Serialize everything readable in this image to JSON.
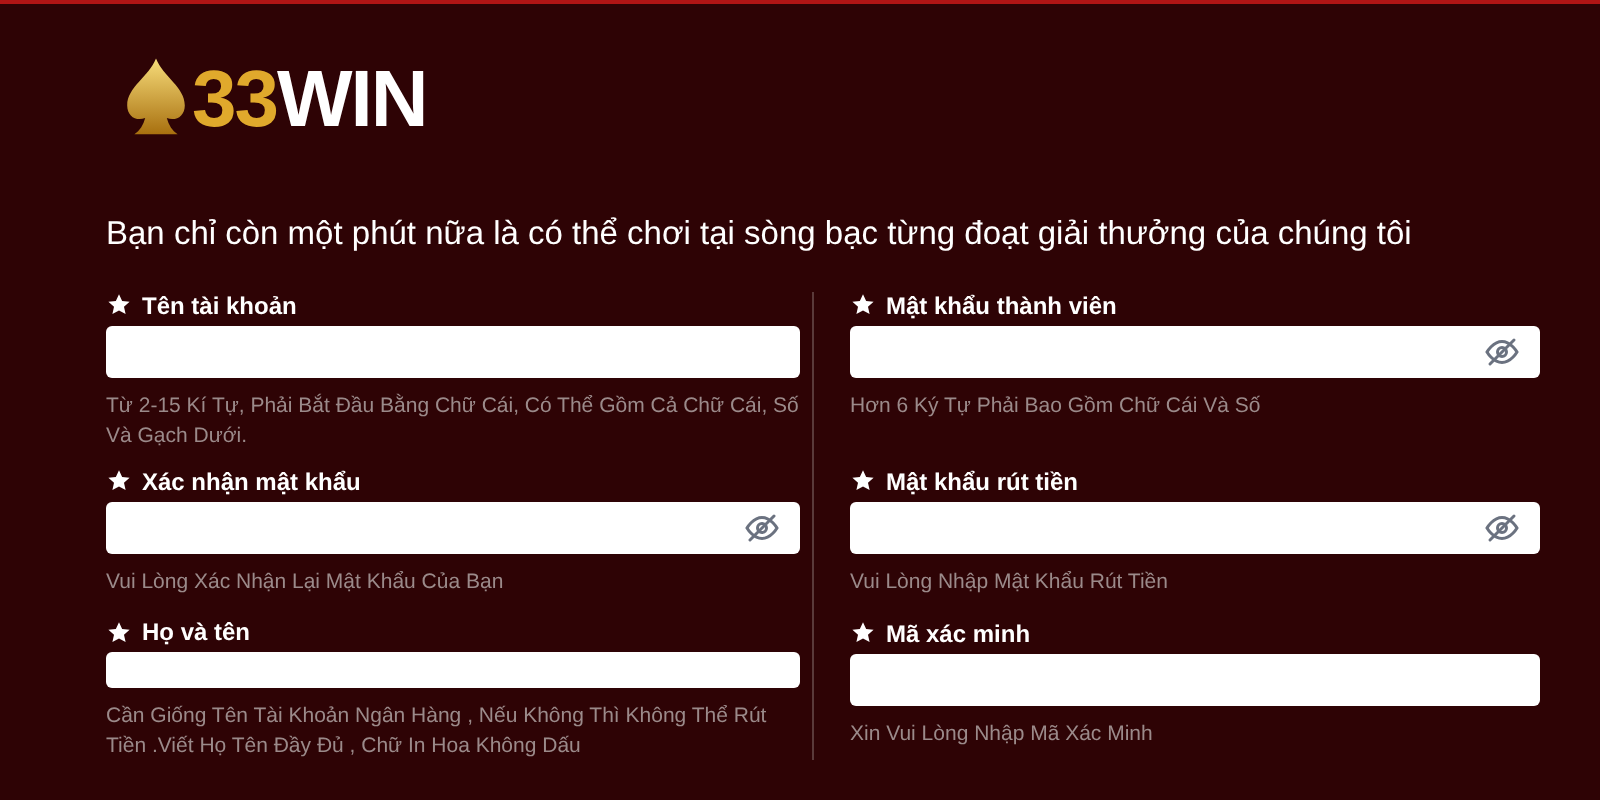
{
  "logo": {
    "digits": "33",
    "word": "WIN"
  },
  "heading": "Bạn chỉ còn một phút nữa là có thể chơi tại sòng bạc từng đoạt giải thưởng của chúng tôi",
  "columns": [
    {
      "fields": [
        {
          "kind": "text",
          "label": "Tên tài khoản",
          "hint": "Từ 2-15 Kí Tự, Phải Bắt Đầu Bằng Chữ Cái, Có Thể Gồm Cả Chữ Cái, Số Và Gạch Dưới."
        },
        {
          "kind": "password",
          "label": "Xác nhận mật khẩu",
          "hint": "Vui Lòng Xác Nhận Lại Mật Khẩu Của Bạn"
        },
        {
          "kind": "text",
          "label": "Họ và tên",
          "hint": "Cần Giống Tên Tài Khoản Ngân Hàng , Nếu Không Thì Không Thể Rút Tiền .Viết Họ Tên Đầy Đủ , Chữ In Hoa Không Dấu"
        }
      ]
    },
    {
      "fields": [
        {
          "kind": "password",
          "label": "Mật khẩu thành viên",
          "hint": "Hơn 6 Ký Tự Phải Bao Gồm Chữ Cái Và Số"
        },
        {
          "kind": "password",
          "label": "Mật khẩu rút tiền",
          "hint": "Vui Lòng Nhập Mật Khẩu Rút Tiền"
        },
        {
          "kind": "text",
          "label": "Mã xác minh",
          "hint": "Xin Vui Lòng Nhập Mã Xác Minh"
        }
      ]
    }
  ]
}
